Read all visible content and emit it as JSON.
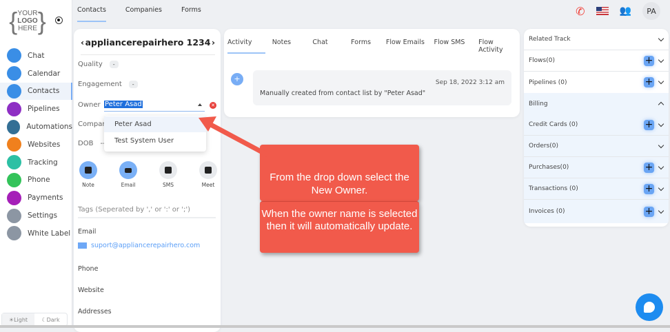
{
  "logo": {
    "text": "YOUR LOGO HERE"
  },
  "sidebar": {
    "items": [
      {
        "label": "Chat",
        "icon": "chat-icon",
        "color": "#3a8ee6"
      },
      {
        "label": "Calendar",
        "icon": "calendar-icon",
        "color": "#3a8ee6"
      },
      {
        "label": "Contacts",
        "icon": "contacts-icon",
        "color": "#3a8ee6",
        "active": true
      },
      {
        "label": "Pipelines",
        "icon": "dollar-icon",
        "color": "#8e2fc4"
      },
      {
        "label": "Automations",
        "icon": "automation-icon",
        "color": "#336f95"
      },
      {
        "label": "Websites",
        "icon": "globe-icon",
        "color": "#f0801d"
      },
      {
        "label": "Tracking",
        "icon": "chart-icon",
        "color": "#2cc0a4"
      },
      {
        "label": "Phone",
        "icon": "phone-icon",
        "color": "#33c35a"
      },
      {
        "label": "Payments",
        "icon": "card-icon",
        "color": "#a51fb8"
      },
      {
        "label": "Settings",
        "icon": "gear-icon",
        "color": "#8c96a3"
      },
      {
        "label": "White Label",
        "icon": "palette-icon",
        "color": "#8c96a3"
      }
    ],
    "theme": {
      "light": "Light",
      "dark": "Dark"
    }
  },
  "topnav": {
    "tabs": [
      "Contacts",
      "Companies",
      "Forms"
    ],
    "avatar": "PA"
  },
  "contact": {
    "name": "appliancerepairhero 1234",
    "quality_label": "Quality",
    "quality_value": "-",
    "engagement_label": "Engagement",
    "engagement_value": "-",
    "owner_label": "Owner",
    "owner_value": "Peter Asad",
    "owner_options": [
      "Peter Asad",
      "Test System User"
    ],
    "company_label": "Company",
    "dob_label": "DOB",
    "dob_value": "--",
    "actions": [
      "Note",
      "Email",
      "SMS",
      "Meet"
    ],
    "tags_placeholder": "Tags (Seperated by ',' or ':' or ';')",
    "email_label": "Email",
    "email_value": "suport@appliancerepairhero.com",
    "phone_label": "Phone",
    "website_label": "Website",
    "addresses_label": "Addresses"
  },
  "activity": {
    "tabs": [
      "Activity",
      "Notes",
      "Chat",
      "Forms",
      "Flow Emails",
      "Flow SMS",
      "Flow Activity"
    ],
    "entry": {
      "timestamp": "Sep 18, 2022 3:12 am",
      "message": "Manually created from contact list by \"Peter Asad\""
    }
  },
  "related": {
    "title": "Related Track",
    "flows": "Flows(0)",
    "pipelines": "Pipelines (0)",
    "billing": "Billing",
    "credit_cards": "Credit Cards (0)",
    "orders": "Orders(0)",
    "purchases": "Purchases(0)",
    "transactions": "Transactions (0)",
    "invoices": "Invoices (0)"
  },
  "callout": {
    "line1": "From the drop down select the New Owner.",
    "line2": "When the owner name is selected then it will automatically update.",
    "color": "#f15a4b"
  }
}
